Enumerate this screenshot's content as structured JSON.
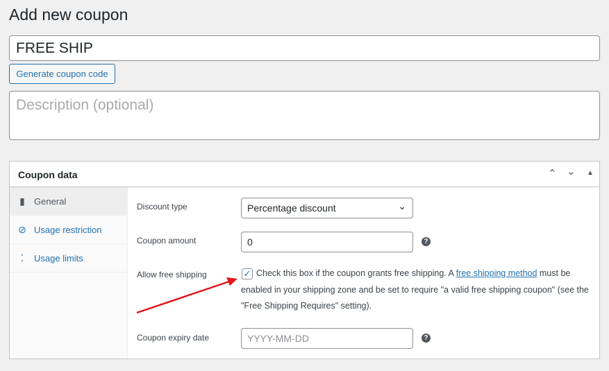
{
  "page": {
    "title": "Add new coupon"
  },
  "coupon": {
    "code": "FREE SHIP",
    "generate_label": "Generate coupon code",
    "description_placeholder": "Description (optional)"
  },
  "panel": {
    "title": "Coupon data",
    "tabs": [
      {
        "label": "General",
        "icon": "ticket-icon"
      },
      {
        "label": "Usage restriction",
        "icon": "block-icon"
      },
      {
        "label": "Usage limits",
        "icon": "limits-icon"
      }
    ],
    "fields": {
      "discount_type": {
        "label": "Discount type",
        "value": "Percentage discount"
      },
      "amount": {
        "label": "Coupon amount",
        "value": "0"
      },
      "free_shipping": {
        "label": "Allow free shipping",
        "checked": true,
        "text_before": "Check this box if the coupon grants free shipping. A ",
        "link": "free shipping method",
        "text_after": " must be enabled in your shipping zone and be set to require \"a valid free shipping coupon\" (see the \"Free Shipping Requires\" setting)."
      },
      "expiry": {
        "label": "Coupon expiry date",
        "placeholder": "YYYY-MM-DD"
      }
    }
  },
  "colors": {
    "accent": "#2271b1",
    "arrow": "#e0161b"
  }
}
